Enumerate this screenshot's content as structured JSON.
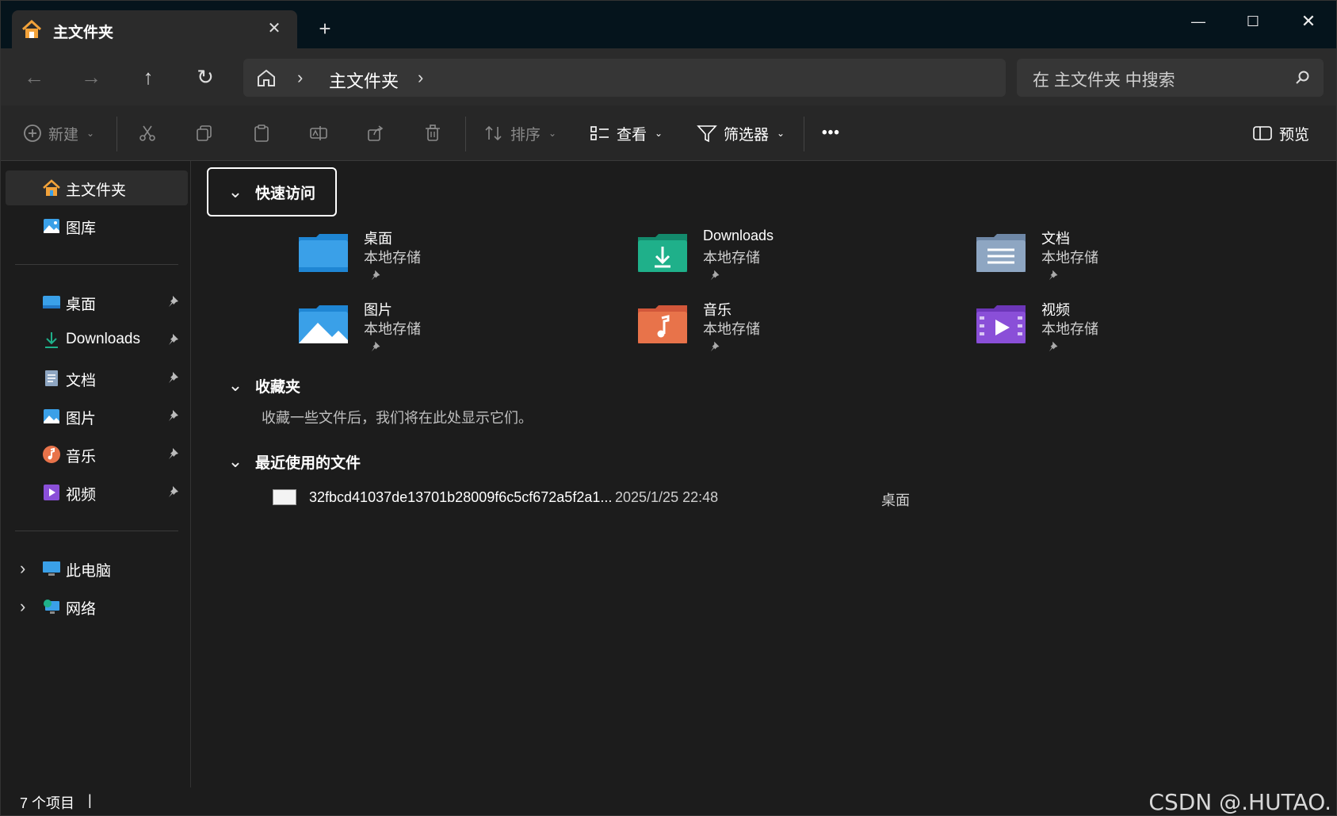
{
  "titlebar": {
    "tab_title": "主文件夹",
    "tab_close": "✕",
    "new_tab": "+",
    "minimize": "—",
    "maximize": "☐",
    "close": "✕"
  },
  "nav": {
    "back": "←",
    "forward": "→",
    "up": "↑",
    "refresh": "↻"
  },
  "address": {
    "crumb": "主文件夹",
    "chevron": "›"
  },
  "search": {
    "placeholder": "在 主文件夹 中搜索"
  },
  "commandbar": {
    "new": "新建",
    "sort": "排序",
    "view": "查看",
    "filter": "筛选器",
    "more": "•••",
    "preview": "预览"
  },
  "sidebar": {
    "top": [
      {
        "label": "主文件夹",
        "icon": "home-icon"
      },
      {
        "label": "图库",
        "icon": "gallery-icon"
      }
    ],
    "pinned": [
      {
        "label": "桌面",
        "icon": "desktop-icon"
      },
      {
        "label": "Downloads",
        "icon": "download-icon"
      },
      {
        "label": "文档",
        "icon": "document-icon"
      },
      {
        "label": "图片",
        "icon": "pictures-icon"
      },
      {
        "label": "音乐",
        "icon": "music-icon"
      },
      {
        "label": "视频",
        "icon": "video-icon"
      }
    ],
    "bottom": [
      {
        "label": "此电脑",
        "icon": "computer-icon"
      },
      {
        "label": "网络",
        "icon": "network-icon"
      }
    ]
  },
  "main": {
    "quick_access_title": "快速访问",
    "favorites_title": "收藏夹",
    "favorites_empty": "收藏一些文件后，我们将在此处显示它们。",
    "recent_title": "最近使用的文件",
    "folders": [
      {
        "name": "桌面",
        "sub": "本地存储",
        "icon": "desktop-folder-icon"
      },
      {
        "name": "Downloads",
        "sub": "本地存储",
        "icon": "downloads-folder-icon"
      },
      {
        "name": "文档",
        "sub": "本地存储",
        "icon": "documents-folder-icon"
      },
      {
        "name": "图片",
        "sub": "本地存储",
        "icon": "pictures-folder-icon"
      },
      {
        "name": "音乐",
        "sub": "本地存储",
        "icon": "music-folder-icon"
      },
      {
        "name": "视频",
        "sub": "本地存储",
        "icon": "videos-folder-icon"
      }
    ],
    "recent": [
      {
        "name": "32fbcd41037de13701b28009f6c5cf672a5f2a1...",
        "date": "2025/1/25 22:48",
        "location": "桌面"
      }
    ]
  },
  "status": {
    "count": "7 个项目",
    "caret": "|"
  },
  "watermark": "CSDN @.HUTAO.",
  "colors": {
    "accent_blue": "#3aa0e8",
    "downloads_green": "#1fb08a",
    "music_orange": "#e8734a",
    "video_purple": "#8a4fd8",
    "docs_gray": "#8ea6c2"
  }
}
